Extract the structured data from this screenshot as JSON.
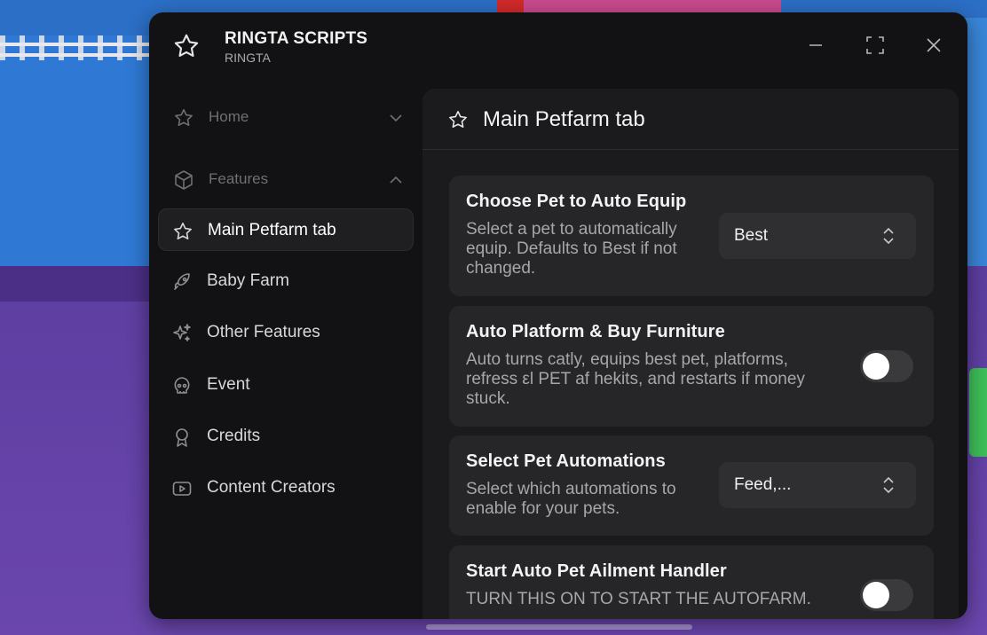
{
  "window": {
    "title": "RINGTA SCRIPTS",
    "subtitle": "RINGTA",
    "icons": {
      "app": "star-icon",
      "minimize": "minimize-icon",
      "maximize": "maximize-icon",
      "close": "close-icon"
    }
  },
  "sidebar": {
    "sections": [
      {
        "label": "Home",
        "icon": "star-icon",
        "chevron": "chevron-down-icon"
      },
      {
        "label": "Features",
        "icon": "cube-icon",
        "chevron": "chevron-up-icon"
      }
    ],
    "items": [
      {
        "label": "Main Petfarm tab",
        "icon": "star-icon",
        "active": true
      },
      {
        "label": "Baby Farm",
        "icon": "rocket-icon",
        "active": false
      },
      {
        "label": "Other Features",
        "icon": "sparkles-icon",
        "active": false
      },
      {
        "label": "Event",
        "icon": "skull-icon",
        "active": false
      },
      {
        "label": "Credits",
        "icon": "award-icon",
        "active": false
      },
      {
        "label": "Content Creators",
        "icon": "youtube-icon",
        "active": false
      }
    ]
  },
  "main": {
    "title": "Main Petfarm tab",
    "title_icon": "star-icon",
    "cards": [
      {
        "title": "Choose Pet to Auto Equip",
        "description_lines": [
          "Select a pet to automatically",
          "equip. Defaults to Best if not",
          "changed."
        ],
        "control": "dropdown",
        "value": "Best"
      },
      {
        "title": "Auto Platform & Buy Furniture",
        "description_lines": [
          "Auto turns catly, equips best pet, platforms,",
          "refress εl PET af hekits, and restarts if money",
          "stuck."
        ],
        "control": "toggle",
        "state": "off"
      },
      {
        "title": "Select Pet Automations",
        "description_lines": [
          "Select which automations to",
          "enable for your pets."
        ],
        "control": "dropdown",
        "value": "Feed,..."
      },
      {
        "title": "Start Auto Pet Ailment Handler",
        "description_lines": [
          "TURN THIS ON TO START THE AUTOFARM."
        ],
        "control": "toggle",
        "state": "off"
      }
    ]
  },
  "colors": {
    "window_bg": "#121214",
    "content_bg": "#1b1b1d",
    "card_bg": "#262628",
    "active_item_bg": "#1f1f22",
    "text_primary": "#f4f4f4",
    "text_muted": "#a7a7ab"
  }
}
